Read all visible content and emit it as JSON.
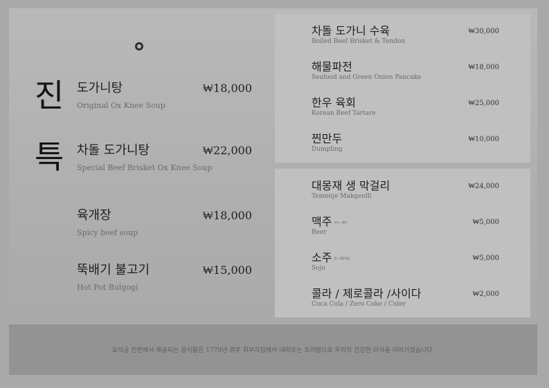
{
  "left_column": {
    "title_chars": [
      "진",
      "특"
    ],
    "items": [
      {
        "name": "도가니탕",
        "sub": "Original Ox Knee Soup",
        "price": "₩18,000"
      },
      {
        "name": "차돌 도가니탕",
        "sub": "Special Beef Brisket Ox Knee Soup",
        "price": "₩22,000"
      },
      {
        "name": "육개장",
        "sub": "Spicy beef soup",
        "price": "₩18,000"
      },
      {
        "name": "뚝배기 불고기",
        "sub": "Hot Pot Bulgogi",
        "price": "₩15,000"
      }
    ]
  },
  "right_top": {
    "items": [
      {
        "name": "차돌 도가니 수육",
        "sub": "Boiled Beef Brisket & Tendon",
        "price": "₩30,000"
      },
      {
        "name": "해물파전",
        "sub": "Seafood and Green Onion Pancake",
        "price": "₩18,000"
      },
      {
        "name": "한우 육회",
        "sub": "Korean Beef Tartare",
        "price": "₩25,000"
      },
      {
        "name": "찐만두",
        "sub": "Dumpling",
        "price": "₩10,000"
      }
    ]
  },
  "right_bottom": {
    "items": [
      {
        "name": "대몽재 생 막걸리",
        "sub": "Temonje Makgeolli",
        "price": "₩24,000"
      },
      {
        "name": "맥주",
        "note": "카스 / 테라",
        "sub": "Beer",
        "price": "₩5,000"
      },
      {
        "name": "소주",
        "note": "참 / 처음처럼",
        "sub": "Soju",
        "price": "₩5,000"
      },
      {
        "name": "콜라 / 제로콜라 /사이다",
        "sub": "Coca Cola / Zero Coke / Cider",
        "price": "₩2,000"
      }
    ]
  },
  "footer": {
    "note": "요석궁 진판에서 제공되는 음식들은 1779년 경주 최부자집에서 내려오는 조리법으로 우리의 건강한 미식을 이어가겠습니다."
  }
}
